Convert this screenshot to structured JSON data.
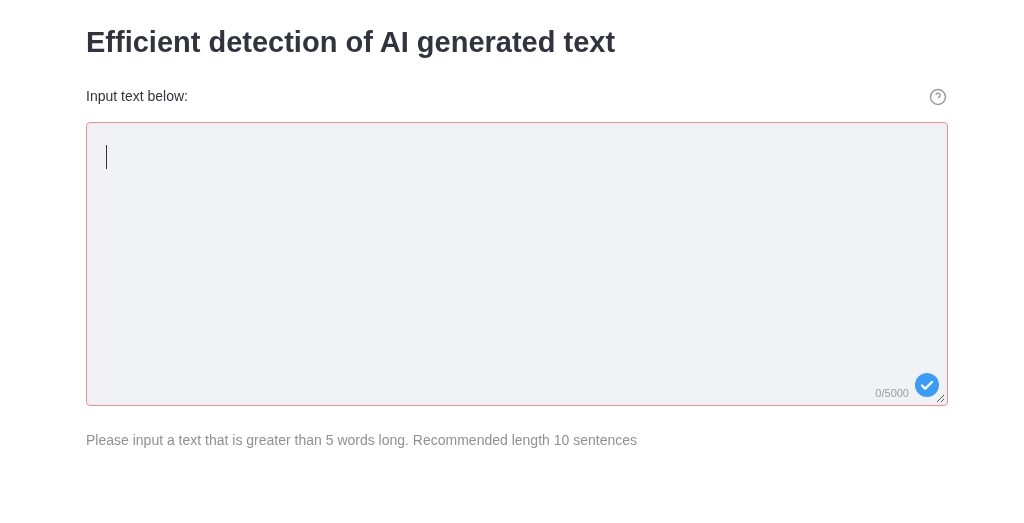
{
  "title": "Efficient detection of AI generated text",
  "input": {
    "label": "Input text below:",
    "focused": true,
    "counter": "0/5000",
    "valid": true
  },
  "help_text": "Please input a text that is greater than 5 words long. Recommended length 10 sentences"
}
